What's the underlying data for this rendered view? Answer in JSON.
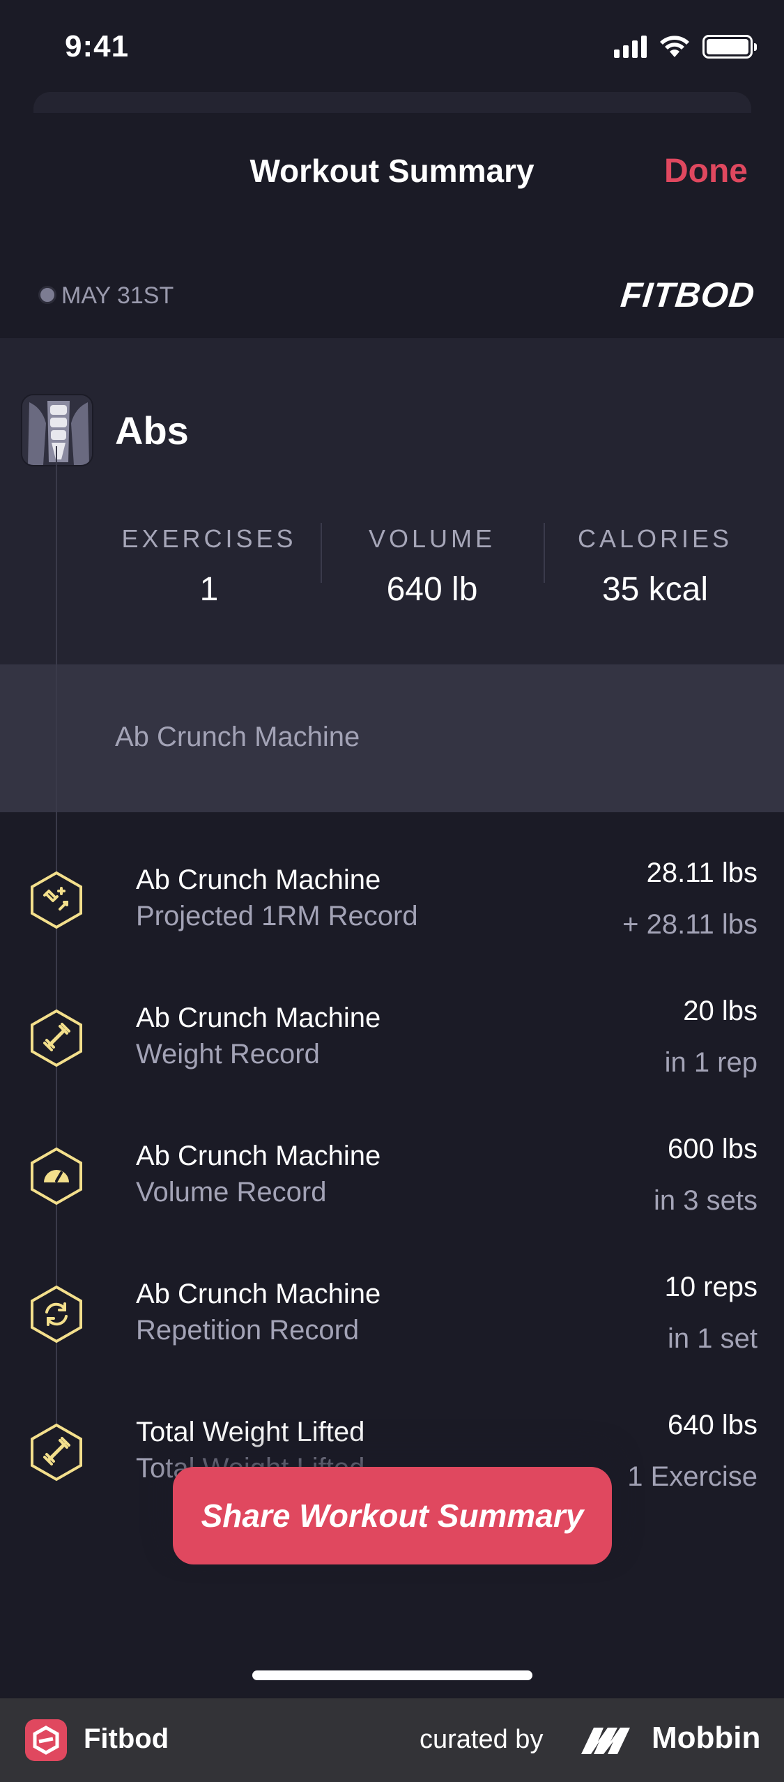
{
  "status_bar": {
    "time": "9:41"
  },
  "nav": {
    "title": "Workout Summary",
    "done_label": "Done"
  },
  "date_row": {
    "date": "MAY 31ST",
    "brand": "FITBOD"
  },
  "workout": {
    "name": "Abs",
    "stats": [
      {
        "label": "EXERCISES",
        "value": "1"
      },
      {
        "label": "VOLUME",
        "value": "640 lb"
      },
      {
        "label": "CALORIES",
        "value": "35 kcal"
      }
    ]
  },
  "exercise_band": {
    "label": "Ab Crunch Machine"
  },
  "records": [
    {
      "icon": "projected-1rm-icon",
      "title": "Ab Crunch Machine",
      "subtitle": "Projected 1RM Record",
      "value": "28.11 lbs",
      "detail": "+ 28.11 lbs"
    },
    {
      "icon": "dumbbell-icon",
      "title": "Ab Crunch Machine",
      "subtitle": "Weight Record",
      "value": "20 lbs",
      "detail": "in 1 rep"
    },
    {
      "icon": "gauge-icon",
      "title": "Ab Crunch Machine",
      "subtitle": "Volume Record",
      "value": "600 lbs",
      "detail": "in 3 sets"
    },
    {
      "icon": "repeat-icon",
      "title": "Ab Crunch Machine",
      "subtitle": "Repetition Record",
      "value": "10 reps",
      "detail": "in 1 set"
    },
    {
      "icon": "dumbbell-icon",
      "title": "Total Weight Lifted",
      "subtitle": "Total Weight Lifted",
      "value": "640 lbs",
      "detail": "1 Exercise"
    }
  ],
  "share_button": {
    "label": "Share Workout Summary"
  },
  "footer": {
    "app_name": "Fitbod",
    "curated_by": "curated by",
    "mobbin": "Mobbin"
  },
  "colors": {
    "accent": "#e0485f",
    "background": "#1b1b26",
    "card": "#242431",
    "icon_gold": "#f3df8c"
  }
}
